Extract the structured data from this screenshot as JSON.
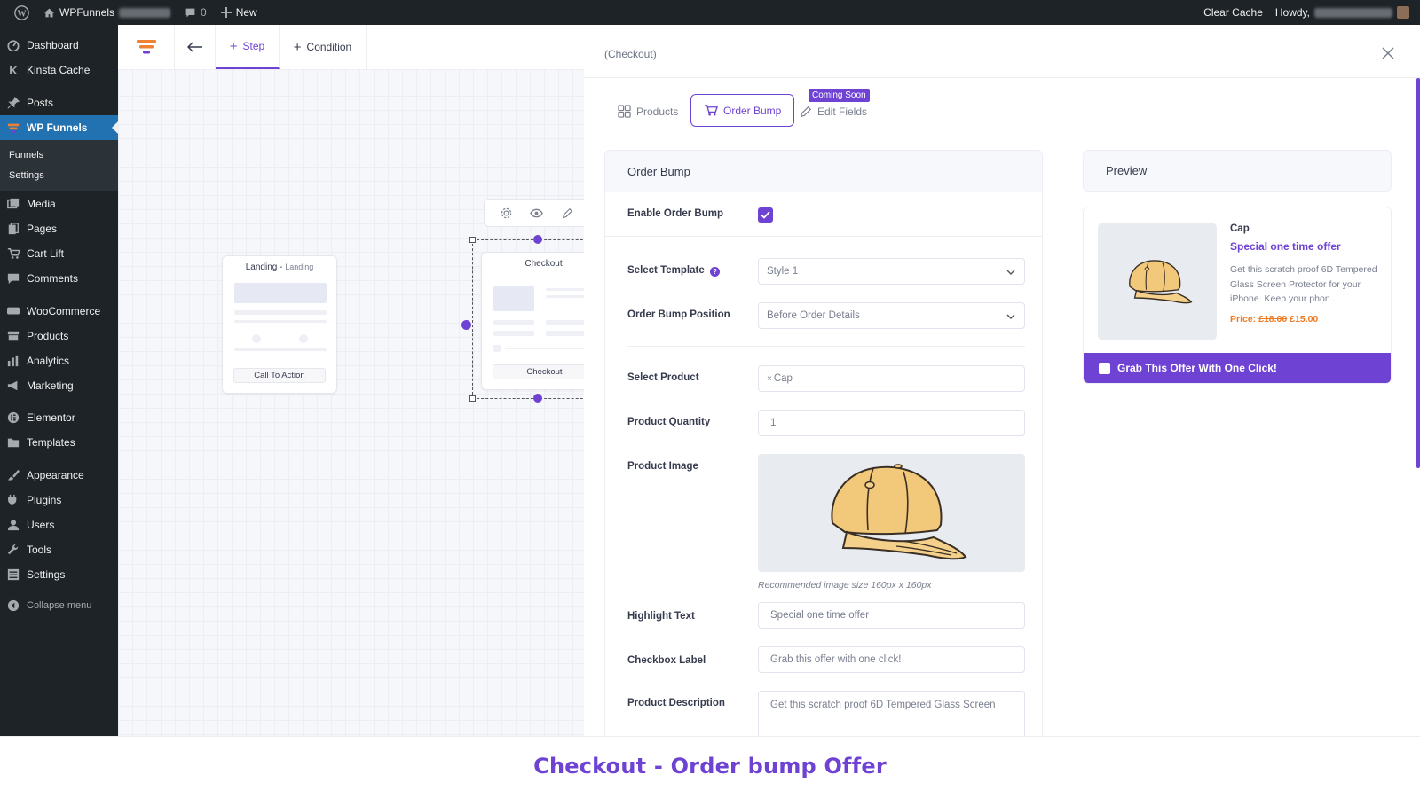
{
  "admin_bar": {
    "site_name": "WPFunnels",
    "comments_count": "0",
    "new_label": "New",
    "clear_cache": "Clear Cache",
    "howdy": "Howdy,"
  },
  "sidebar": {
    "items": [
      {
        "label": "Dashboard",
        "icon": "dashboard-icon"
      },
      {
        "label": "Kinsta Cache",
        "icon": "kinsta-icon"
      },
      {
        "label": "Posts",
        "icon": "pin-icon"
      },
      {
        "label": "WP Funnels",
        "icon": "funnel-icon"
      },
      {
        "label": "Media",
        "icon": "media-icon"
      },
      {
        "label": "Pages",
        "icon": "pages-icon"
      },
      {
        "label": "Cart Lift",
        "icon": "cart-icon"
      },
      {
        "label": "Comments",
        "icon": "comment-icon"
      },
      {
        "label": "WooCommerce",
        "icon": "woo-icon"
      },
      {
        "label": "Products",
        "icon": "archive-icon"
      },
      {
        "label": "Analytics",
        "icon": "chart-icon"
      },
      {
        "label": "Marketing",
        "icon": "megaphone-icon"
      },
      {
        "label": "Elementor",
        "icon": "elementor-icon"
      },
      {
        "label": "Templates",
        "icon": "folder-icon"
      },
      {
        "label": "Appearance",
        "icon": "brush-icon"
      },
      {
        "label": "Plugins",
        "icon": "plug-icon"
      },
      {
        "label": "Users",
        "icon": "user-icon"
      },
      {
        "label": "Tools",
        "icon": "wrench-icon"
      },
      {
        "label": "Settings",
        "icon": "settings-icon"
      }
    ],
    "submenu": [
      "Funnels",
      "Settings"
    ],
    "collapse": "Collapse menu",
    "active": "WP Funnels"
  },
  "builder": {
    "toolbar": {
      "step": "Step",
      "condition": "Condition"
    },
    "landing_node": {
      "title": "Landing",
      "subtitle": "Landing",
      "button": "Call To Action"
    },
    "checkout_node": {
      "title": "Checkout",
      "button": "Checkout"
    }
  },
  "drawer": {
    "title": "(Checkout)",
    "tabs": [
      "Products",
      "Order Bump",
      "Edit Fields"
    ],
    "active_tab": "Order Bump",
    "coming_soon": "Coming Soon",
    "order_bump": {
      "header": "Order Bump",
      "enable_label": "Enable Order Bump",
      "enable_checked": true,
      "template_label": "Select Template",
      "template_value": "Style 1",
      "position_label": "Order Bump Position",
      "position_value": "Before Order Details",
      "product_label": "Select Product",
      "product_value": "Cap",
      "product_remove": "×",
      "quantity_label": "Product Quantity",
      "quantity_value": "1",
      "image_label": "Product Image",
      "image_hint": "Recommended image size 160px x 160px",
      "highlight_label": "Highlight Text",
      "highlight_value": "Special one time offer",
      "checkbox_label_label": "Checkbox Label",
      "checkbox_label_value": "Grab this offer with one click!",
      "description_label": "Product Description",
      "description_value": "Get this scratch proof 6D Tempered Glass Screen"
    },
    "preview": {
      "header": "Preview",
      "product_name": "Cap",
      "highlight": "Special one time offer",
      "description": "Get this scratch proof 6D Tempered Glass Screen Protector for your iPhone. Keep your phon...",
      "price_prefix": "Price:",
      "price_old": "£18.00",
      "price_new": "£15.00",
      "cta": "Grab This Offer With One Click!"
    }
  },
  "caption": "Checkout - Order bump Offer",
  "colors": {
    "accent": "#6e42d3",
    "wp_dark": "#1d2327",
    "wp_blue": "#2271b1",
    "price": "#ef7a21"
  }
}
